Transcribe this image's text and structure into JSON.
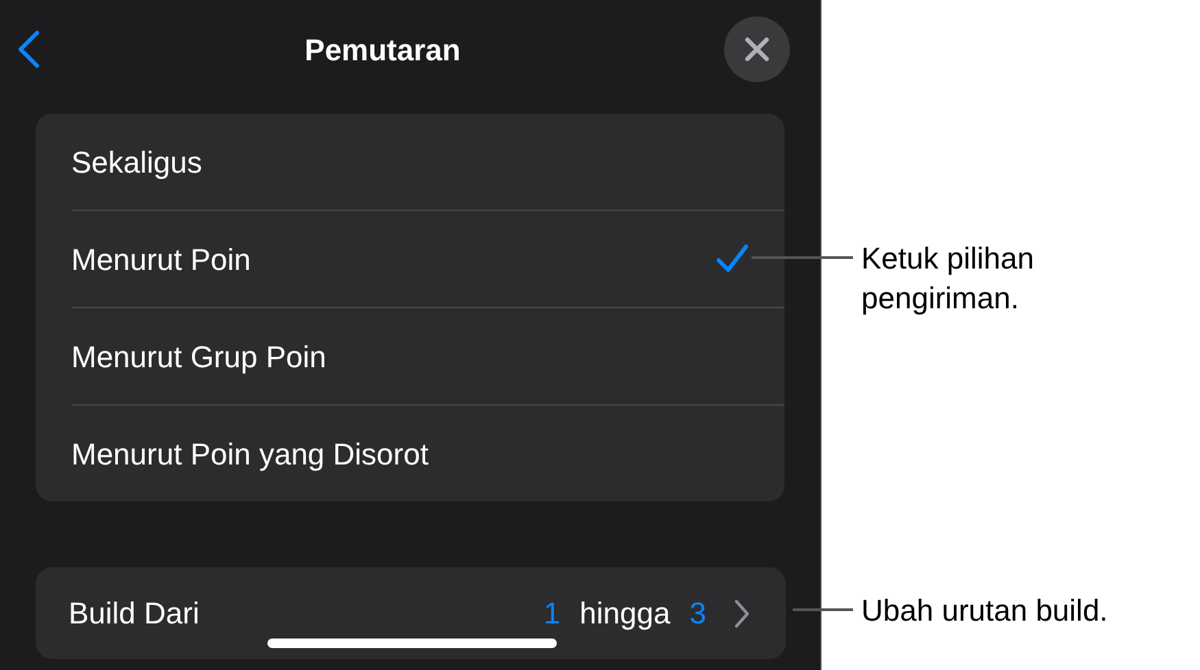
{
  "header": {
    "title": "Pemutaran"
  },
  "options": [
    {
      "label": "Sekaligus",
      "selected": false
    },
    {
      "label": "Menurut Poin",
      "selected": true
    },
    {
      "label": "Menurut Grup Poin",
      "selected": false
    },
    {
      "label": "Menurut Poin yang Disorot",
      "selected": false
    }
  ],
  "build": {
    "label": "Build Dari",
    "from": "1",
    "connector": "hingga",
    "to": "3"
  },
  "callouts": [
    {
      "text": "Ketuk pilihan pengiriman."
    },
    {
      "text": "Ubah urutan build."
    }
  ]
}
